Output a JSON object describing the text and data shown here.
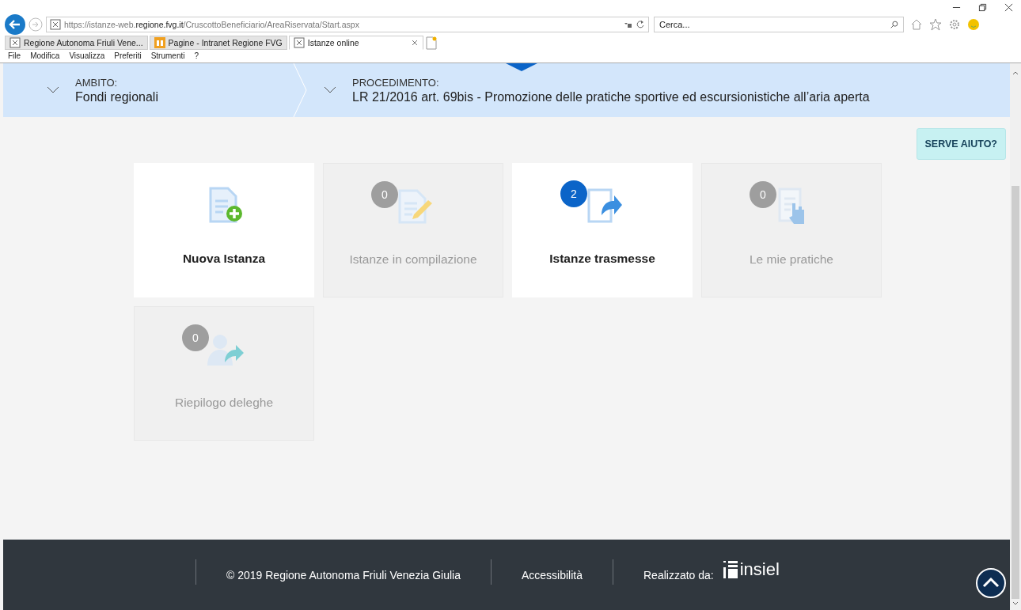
{
  "browser": {
    "url": "https://istanze-web.**regione.fvg.it**/CruscottoBeneficiario/AreaRiservata/Start.aspx",
    "search_placeholder": "Cerca...",
    "tabs": [
      {
        "label": "Regione Autonoma Friuli Vene...",
        "selected": false,
        "kind": "page"
      },
      {
        "label": "Pagine - Intranet Regione FVG",
        "selected": false,
        "kind": "intranet"
      },
      {
        "label": "Istanze online",
        "selected": true,
        "kind": "page"
      }
    ],
    "menu": [
      "File",
      "Modifica",
      "Visualizza",
      "Preferiti",
      "Strumenti",
      "?"
    ]
  },
  "breadcrumb": [
    {
      "label": "AMBITO:",
      "value": "Fondi regionali"
    },
    {
      "label": "PROCEDIMENTO:",
      "value": "LR 21/2016 art. 69bis - Promozione delle pratiche sportive ed escursionistiche all’aria aperta"
    }
  ],
  "help_button": "SERVE AIUTO?",
  "tiles": [
    {
      "kind": "new",
      "label": "Nuova Istanza",
      "disabled": false
    },
    {
      "kind": "draft",
      "label": "Istanze in compilazione",
      "count": "0",
      "disabled": true
    },
    {
      "kind": "sent",
      "label": "Istanze trasmesse",
      "count": "2",
      "disabled": false
    },
    {
      "kind": "practice",
      "label": "Le mie pratiche",
      "count": "0",
      "disabled": true
    },
    {
      "kind": "delegation",
      "label": "Riepilogo deleghe",
      "count": "0",
      "disabled": true
    }
  ],
  "footer": {
    "copyright": "© 2019 Regione Autonoma Friuli Venezia Giulia",
    "accessibility": "Accessibilità",
    "made_by": "Realizzato da:",
    "logo": "insiel"
  }
}
